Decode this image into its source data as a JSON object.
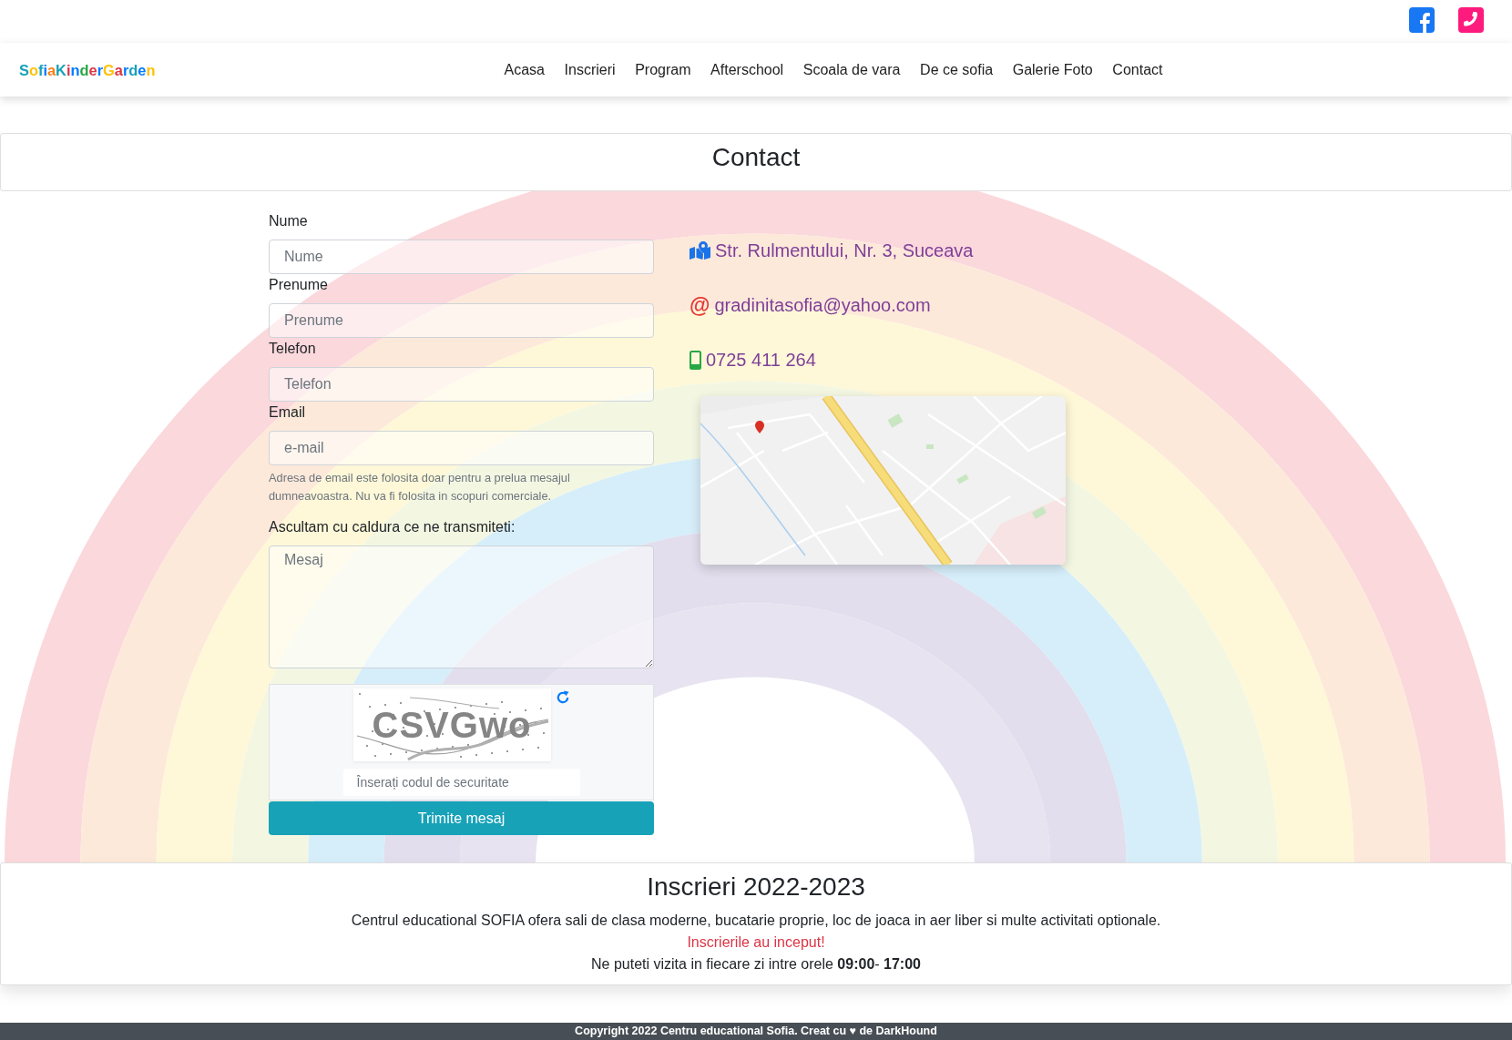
{
  "navbar": {
    "logo": {
      "letters": [
        {
          "char": "S",
          "color": "#17a2b8"
        },
        {
          "char": "o",
          "color": "#ffc107"
        },
        {
          "char": "f",
          "color": "#17a2b8"
        },
        {
          "char": "i",
          "color": "#007bff"
        },
        {
          "char": "a",
          "color": "#fd7e14"
        },
        {
          "char": "K",
          "color": "#17a2b8"
        },
        {
          "char": "i",
          "color": "#dc3545"
        },
        {
          "char": "n",
          "color": "#007bff"
        },
        {
          "char": "d",
          "color": "#28a745"
        },
        {
          "char": "e",
          "color": "#dc3545"
        },
        {
          "char": "r",
          "color": "#007bff"
        },
        {
          "char": "G",
          "color": "#ffc107"
        },
        {
          "char": "a",
          "color": "#dc3545"
        },
        {
          "char": "r",
          "color": "#007bff"
        },
        {
          "char": "d",
          "color": "#17a2b8"
        },
        {
          "char": "e",
          "color": "#007bff"
        },
        {
          "char": "n",
          "color": "#ffc107"
        }
      ]
    },
    "links": [
      "Acasa",
      "Inscrieri",
      "Program",
      "Afterschool",
      "Scoala de vara",
      "De ce sofia",
      "Galerie Foto",
      "Contact"
    ]
  },
  "page_header": {
    "title": "Contact"
  },
  "form": {
    "fields": [
      {
        "label": "Nume",
        "placeholder": "Nume"
      },
      {
        "label": "Prenume",
        "placeholder": "Prenume"
      },
      {
        "label": "Telefon",
        "placeholder": "Telefon"
      },
      {
        "label": "Email",
        "placeholder": "e-mail",
        "help": "Adresa de email este folosita doar pentru a prelua mesajul dumneavoastra. Nu va fi folosita in scopuri comerciale."
      }
    ],
    "message": {
      "label": "Ascultam cu caldura ce ne transmiteti:",
      "placeholder": "Mesaj"
    },
    "captcha": {
      "code": "CSVGwo",
      "placeholder": "Înserați codul de securitate"
    },
    "submit": "Trimite mesaj"
  },
  "contact_info": [
    {
      "kind": "address",
      "text": "Str. Rulmentului, Nr. 3, Suceava"
    },
    {
      "kind": "email",
      "icon": "@",
      "text": "gradinitasofia@yahoo.com"
    },
    {
      "kind": "phone",
      "text": "0725 411 264"
    }
  ],
  "enrollment": {
    "title": "Inscrieri 2022-2023",
    "description": "Centrul educational SOFIA ofera sali de clasa moderne, bucatarie proprie, loc de joaca in aer liber si multe activitati optionale.",
    "notice": "Inscrierile au inceput!",
    "hours": "Ne puteti vizita in fiecare zi intre orele **09:00**- **17:00**"
  },
  "footer": {
    "text": "Copyright 2022 Centru educational Sofia. Creat cu ♥ de DarkHound"
  }
}
